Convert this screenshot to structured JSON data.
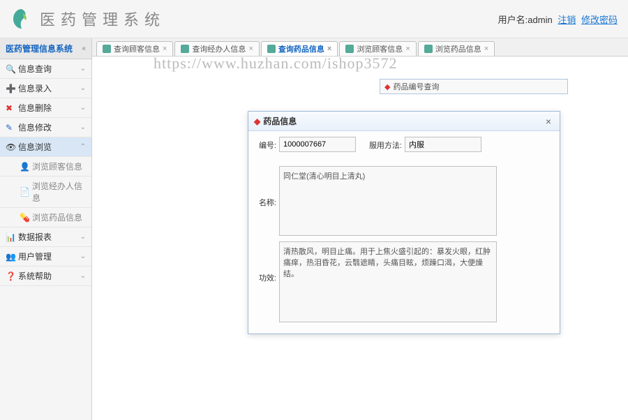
{
  "header": {
    "system_title": "医药管理系统",
    "user_label": "用户名:",
    "username": "admin",
    "logout": "注销",
    "change_pwd": "修改密码"
  },
  "sidebar": {
    "title": "医药管理信息系统",
    "items": [
      {
        "label": "信息查询",
        "icon": "search"
      },
      {
        "label": "信息录入",
        "icon": "add"
      },
      {
        "label": "信息删除",
        "icon": "delete"
      },
      {
        "label": "信息修改",
        "icon": "edit"
      },
      {
        "label": "信息浏览",
        "icon": "browse",
        "active": true
      },
      {
        "label": "数据报表",
        "icon": "report"
      },
      {
        "label": "用户管理",
        "icon": "user"
      },
      {
        "label": "系统帮助",
        "icon": "help"
      }
    ],
    "subitems": [
      {
        "label": "浏览顾客信息",
        "icon": "person"
      },
      {
        "label": "浏览经办人信息",
        "icon": "doc"
      },
      {
        "label": "浏览药品信息",
        "icon": "pill"
      }
    ]
  },
  "tabs": [
    {
      "label": "查询顾客信息"
    },
    {
      "label": "查询经办人信息"
    },
    {
      "label": "查询药品信息",
      "active": true
    },
    {
      "label": "浏览顾客信息"
    },
    {
      "label": "浏览药品信息"
    }
  ],
  "bg_panel": {
    "title": "药品编号查询"
  },
  "dialog": {
    "title": "药品信息",
    "fields": {
      "id_label": "编号:",
      "id_value": "1000007667",
      "usage_label": "服用方法:",
      "usage_value": "内服",
      "name_label": "名称:",
      "name_value": "同仁堂(清心明目上清丸)",
      "effect_label": "功效:",
      "effect_value": "清热散风，明目止痛。用于上焦火盛引起的：暴发火眼，红肿痛痒，热泪昏花，云翳遮睛，头痛目眩，烦躁口渴，大便燥结。"
    }
  },
  "watermark": "https://www.huzhan.com/ishop3572"
}
